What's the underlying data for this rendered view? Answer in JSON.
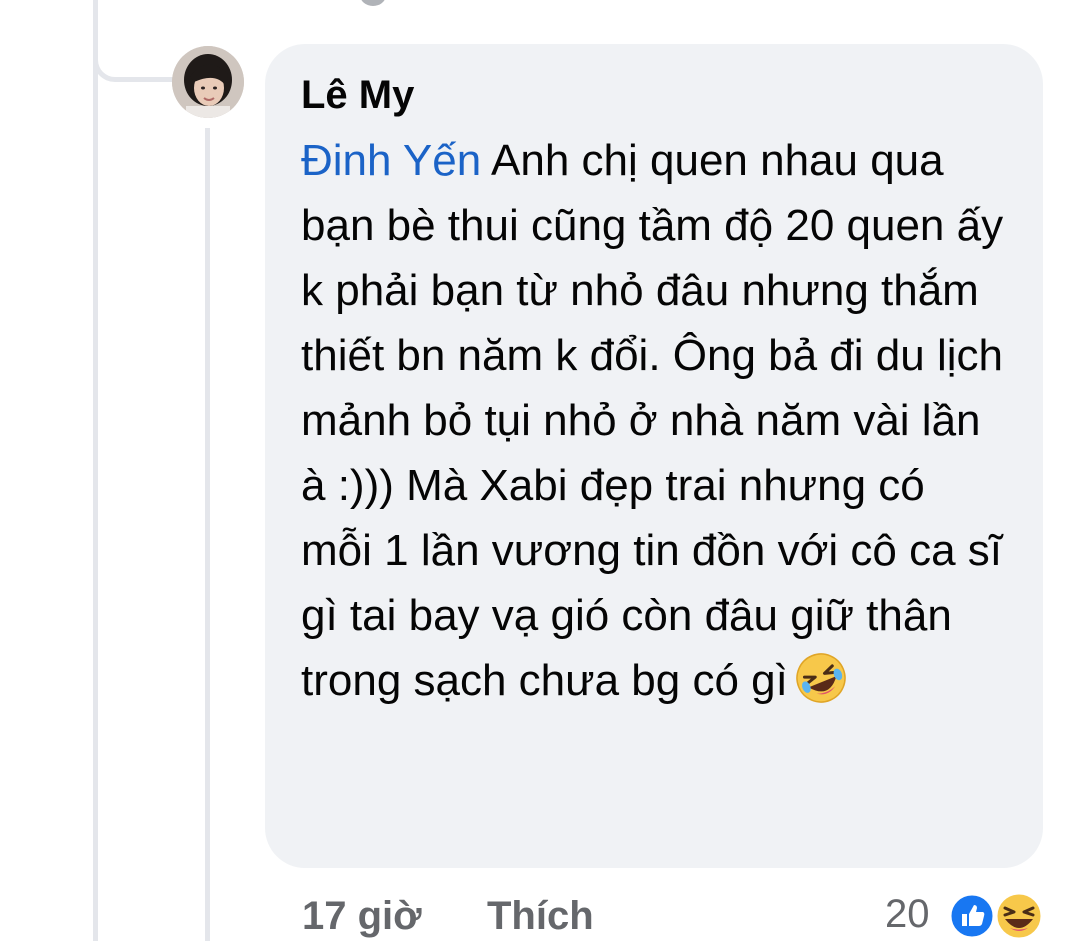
{
  "comment": {
    "author": "Lê My",
    "mention": "Đinh Yến",
    "text": " Anh chị quen nhau qua bạn bè thui cũng tầm độ 20 quen ấy k phải bạn từ nhỏ đâu nhưng thắm thiết bn năm k đổi. Ông bả đi du lịch mảnh bỏ tụi nhỏ ở nhà năm vài lần à :))) Mà Xabi đẹp trai nhưng có mỗi 1 lần vương tin đồn với cô ca sĩ gì tai bay vạ gió còn đâu giữ thân trong sạch chưa bg có gì",
    "emoji": "rolling-on-floor-laughing-emoji"
  },
  "footer": {
    "timestamp": "17 giờ",
    "like_label": "Thích",
    "reaction_count": "20",
    "reactions": [
      "like-icon",
      "haha-icon"
    ]
  },
  "colors": {
    "bubble": "#f0f2f5",
    "mention": "#1b63c7",
    "meta_text": "#65676b",
    "like_blue": "#1877f2",
    "haha_yellow": "#f7c84a"
  }
}
